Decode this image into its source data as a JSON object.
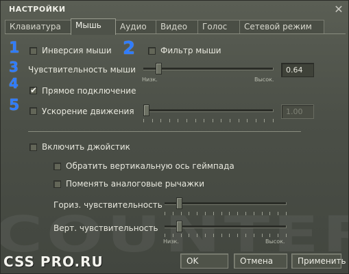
{
  "window": {
    "title": "НАСТРОЙКИ",
    "close_glyph": "✕"
  },
  "tabs": [
    {
      "label": "Клавиатура",
      "active": false
    },
    {
      "label": "Мышь",
      "active": true
    },
    {
      "label": "Аудио",
      "active": false
    },
    {
      "label": "Видео",
      "active": false
    },
    {
      "label": "Голос",
      "active": false
    },
    {
      "label": "Сетевой режим",
      "active": false
    }
  ],
  "annotations": [
    "1",
    "2",
    "3",
    "4",
    "5"
  ],
  "mouse": {
    "invert": {
      "label": "Инверсия мыши",
      "checked": false
    },
    "filter": {
      "label": "Фильтр мыши",
      "checked": false
    },
    "sensitivity": {
      "label": "Чувствительность мыши",
      "value": "0.64",
      "level": 0.1,
      "min_label": "Низк.",
      "max_label": "Высок."
    },
    "raw_input": {
      "label": "Прямое подключение",
      "checked": true,
      "check_glyph": "✔"
    },
    "acceleration": {
      "label": "Ускорение движения",
      "checked": false,
      "value": "1.00",
      "level": 0.0
    }
  },
  "joystick": {
    "enable": {
      "label": "Включить джойстик",
      "checked": false
    },
    "invert_vertical": {
      "label": "Обратить вертикальную ось геймпада",
      "checked": false
    },
    "swap_sticks": {
      "label": "Поменять аналоговые рычажки",
      "checked": false
    },
    "horiz_sens": {
      "label": "Гориз. чувствительность",
      "level": 0.1
    },
    "vert_sens": {
      "label": "Верт. чувствительность",
      "level": 0.1,
      "min_label": "Низк.",
      "max_label": "Высок."
    }
  },
  "buttons": {
    "ok": "OK",
    "cancel": "Отмена",
    "apply": "Применить"
  },
  "logo": {
    "text": "CSS PRO.RU"
  },
  "watermark": {
    "text": "COUNTER"
  },
  "colors": {
    "annotation_blue": "#2f7cff",
    "panel_bg": "#4c5047"
  },
  "icons": {
    "close": "close-icon",
    "check": "check-icon"
  }
}
